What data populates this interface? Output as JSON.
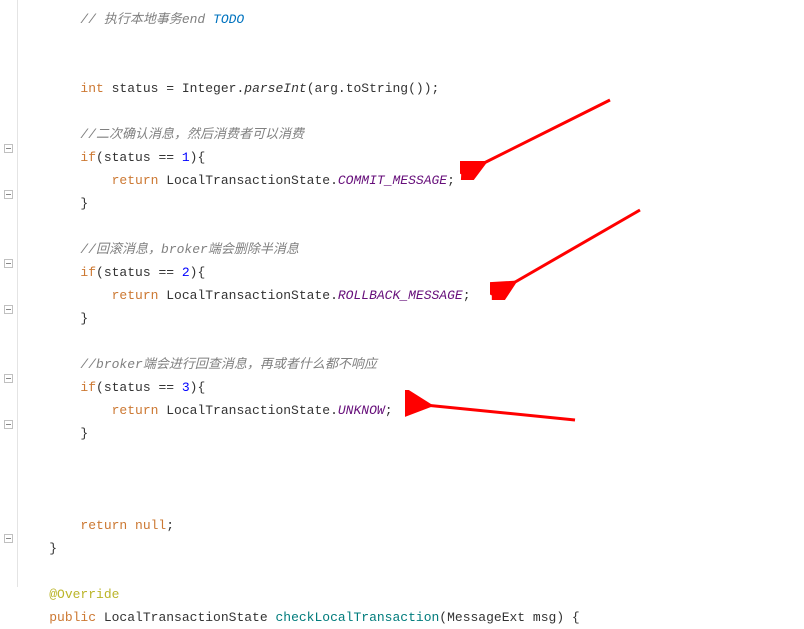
{
  "code": {
    "line1_comment": "// 执行本地事务end ",
    "line1_todo": "TODO",
    "line3_kw_int": "int",
    "line3_var": " status = Integer.",
    "line3_method": "parseInt",
    "line3_rest": "(arg.toString());",
    "line5_comment": "//二次确认消息，然后消费者可以消费",
    "line6_kw_if": "if",
    "line6_cond": "(status == ",
    "line6_num": "1",
    "line6_brace": "){",
    "line7_kw_return": "return",
    "line7_class": " LocalTransactionState.",
    "line7_field": "COMMIT_MESSAGE",
    "line7_semi": ";",
    "line8_brace": "}",
    "line10_comment": "//回滚消息，broker端会删除半消息",
    "line11_kw_if": "if",
    "line11_cond": "(status == ",
    "line11_num": "2",
    "line11_brace": "){",
    "line12_kw_return": "return",
    "line12_class": " LocalTransactionState.",
    "line12_field": "ROLLBACK_MESSAGE",
    "line12_semi": ";",
    "line13_brace": "}",
    "line15_comment": "//broker端会进行回查消息，再或者什么都不响应",
    "line16_kw_if": "if",
    "line16_cond": "(status == ",
    "line16_num": "3",
    "line16_brace": "){",
    "line17_kw_return": "return",
    "line17_class": " LocalTransactionState.",
    "line17_field": "UNKNOW",
    "line17_semi": ";",
    "line18_brace": "}",
    "line22_kw_return": "return null",
    "line22_semi": ";",
    "line23_brace": "}",
    "line25_annotation": "@Override",
    "line26_kw_public": "public",
    "line26_ret_type": " LocalTransactionState ",
    "line26_method": "checkLocalTransaction",
    "line26_params": "(MessageExt msg) {"
  },
  "arrows_color": "#ff0000"
}
